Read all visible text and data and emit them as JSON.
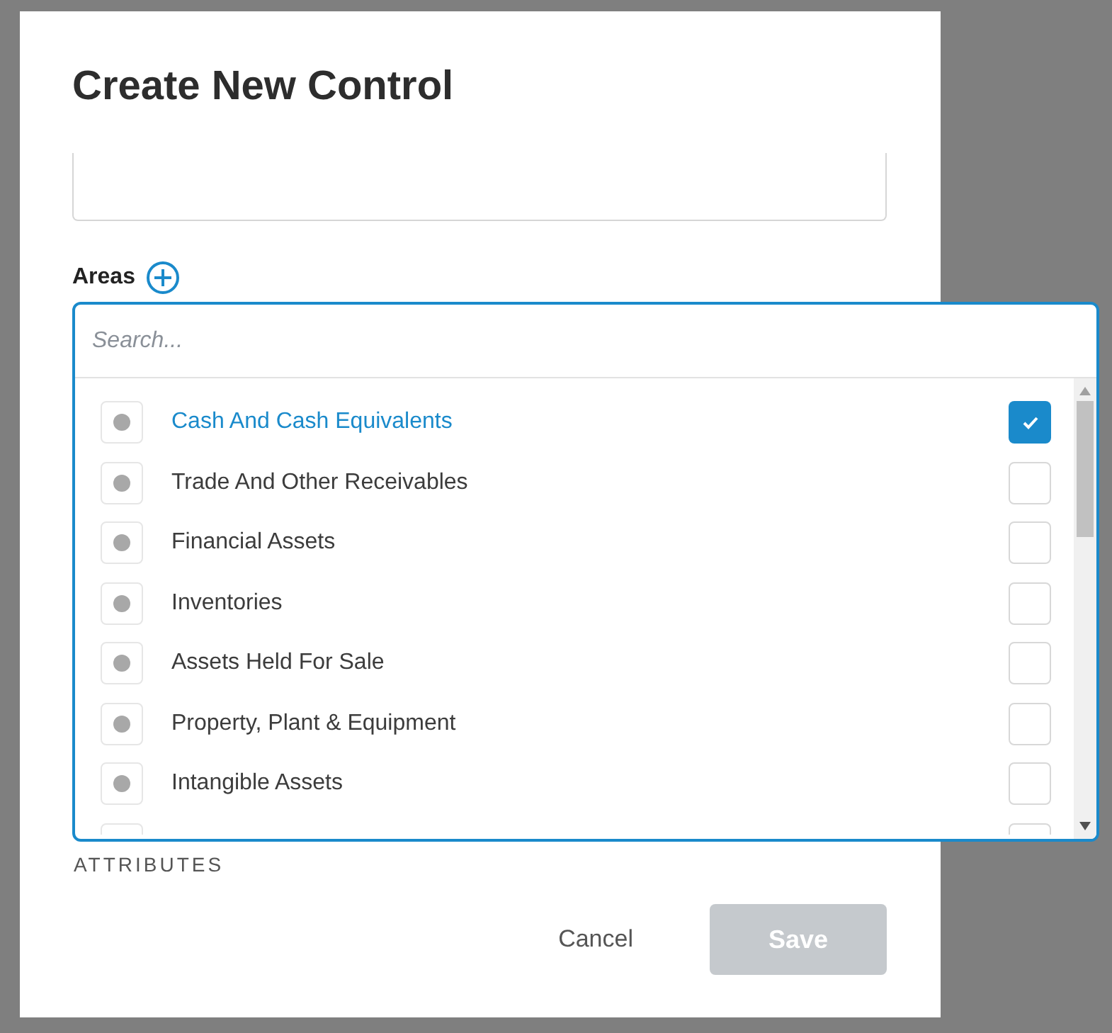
{
  "dialog": {
    "title": "Create New Control",
    "areas_label": "Areas",
    "section_label": "ATTRIBUTES",
    "dropdown": {
      "search_placeholder": "Search...",
      "items": [
        {
          "label": "Cash And Cash Equivalents",
          "checked": true
        },
        {
          "label": "Trade And Other Receivables",
          "checked": false
        },
        {
          "label": "Financial Assets",
          "checked": false
        },
        {
          "label": "Inventories",
          "checked": false
        },
        {
          "label": "Assets Held For Sale",
          "checked": false
        },
        {
          "label": "Property, Plant & Equipment",
          "checked": false
        },
        {
          "label": "Intangible Assets",
          "checked": false
        }
      ]
    },
    "buttons": [
      {
        "label": "Cancel",
        "kind": "link",
        "disabled": false
      },
      {
        "label": "Save",
        "kind": "primary",
        "disabled": true
      }
    ]
  }
}
